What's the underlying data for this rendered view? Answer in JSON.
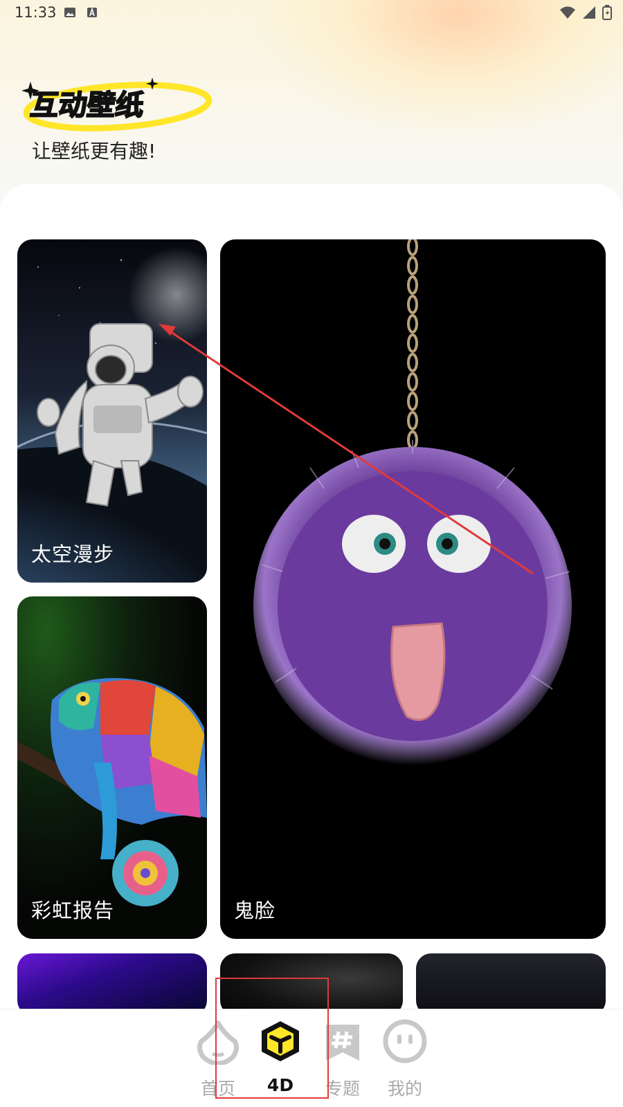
{
  "status_bar": {
    "time": "11:33"
  },
  "header": {
    "logo_text": "互动壁纸",
    "subtitle": "让壁纸更有趣!"
  },
  "cards": [
    {
      "label": "太空漫步"
    },
    {
      "label": "鬼脸"
    },
    {
      "label": "彩虹报告"
    }
  ],
  "tabbar": {
    "items": [
      {
        "label": "首页",
        "icon": "home-icon",
        "active": false
      },
      {
        "label": "4D",
        "icon": "cube-icon",
        "active": true
      },
      {
        "label": "专题",
        "icon": "hashtag-icon",
        "active": false
      },
      {
        "label": "我的",
        "icon": "face-icon",
        "active": false
      }
    ]
  },
  "colors": {
    "accent_yellow": "#ffe629",
    "annotation_red": "#e03a3a"
  }
}
